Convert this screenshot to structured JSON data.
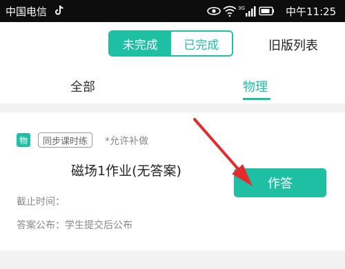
{
  "status_bar": {
    "carrier": "中国电信",
    "time": "中午11:25",
    "network_label": "3G",
    "icons": [
      "tiktok-icon",
      "eye-icon",
      "wifi-icon",
      "signal-icon",
      "battery-icon"
    ]
  },
  "header": {
    "segment": {
      "active_label": "未完成",
      "inactive_label": "已完成"
    },
    "old_list_label": "旧版列表",
    "tabs": [
      {
        "label": "全部",
        "active": false
      },
      {
        "label": "物理",
        "active": true
      }
    ]
  },
  "card": {
    "subject_badge": "物",
    "type_tag": "同步课时练",
    "allow_note": "*允许补做",
    "title": "磁场1作业(无答案)",
    "deadline_label": "截止时间：",
    "publish_label": "答案公布：学生提交后公布",
    "answer_button": "作答"
  },
  "colors": {
    "accent": "#1fbfa4",
    "arrow": "#e52b2b",
    "status_bar_bg": "#0d0d0d"
  }
}
